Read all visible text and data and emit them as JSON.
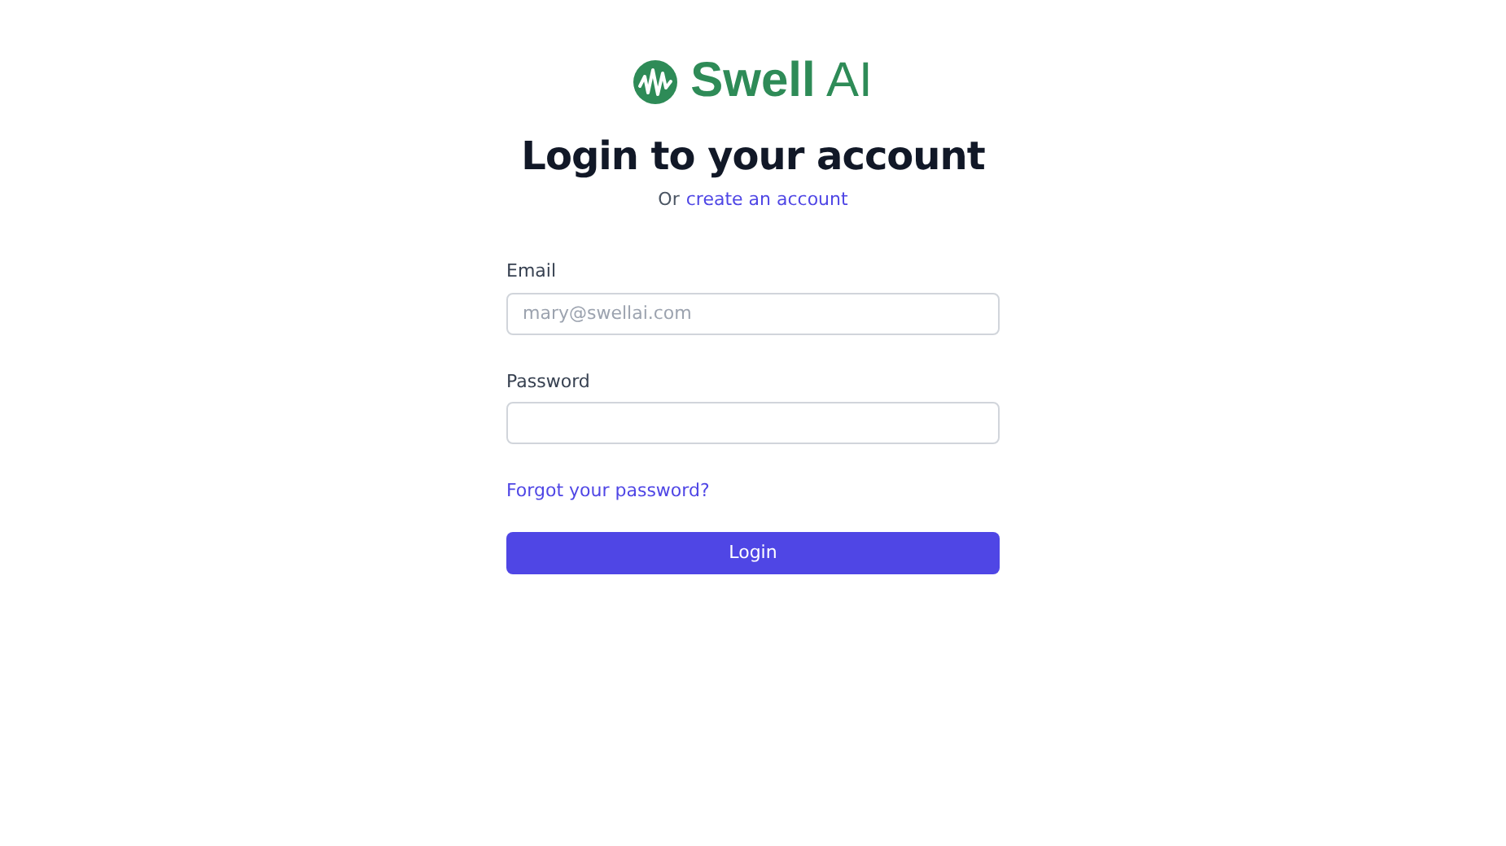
{
  "logo": {
    "text": "**Swell** AI"
  },
  "heading": "Login to your account",
  "subheading": {
    "prefix": "Or",
    "link": "create an account"
  },
  "fields": [
    {
      "label": "Email",
      "placeholder": "mary@swellai.com"
    },
    {
      "label": "Password"
    }
  ],
  "forgot_link": "Forgot your password?",
  "submit_button": "Login"
}
